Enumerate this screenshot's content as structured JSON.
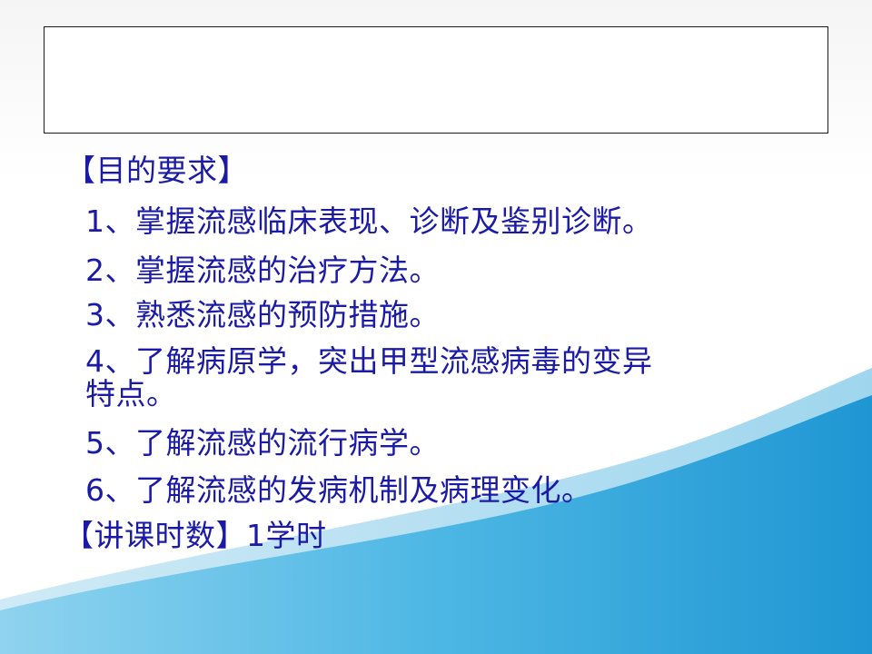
{
  "slide": {
    "section_heading": "【目的要求】",
    "items": [
      "1、掌握流感临床表现、诊断及鉴别诊断。",
      "2、掌握流感的治疗方法。",
      "3、熟悉流感的预防措施。",
      "4、了解病原学，突出甲型流感病毒的变异",
      "5、了解流感的流行病学。",
      "6、了解流感的发病机制及病理变化。"
    ],
    "item4_continuation": "特点。",
    "lecture_hours": "【讲课时数】1学时"
  },
  "colors": {
    "text": "#1a1aa6",
    "wave_light": "#7cc9ea",
    "wave_dark": "#1f9ad6",
    "title_border": "#1a1a1a"
  }
}
